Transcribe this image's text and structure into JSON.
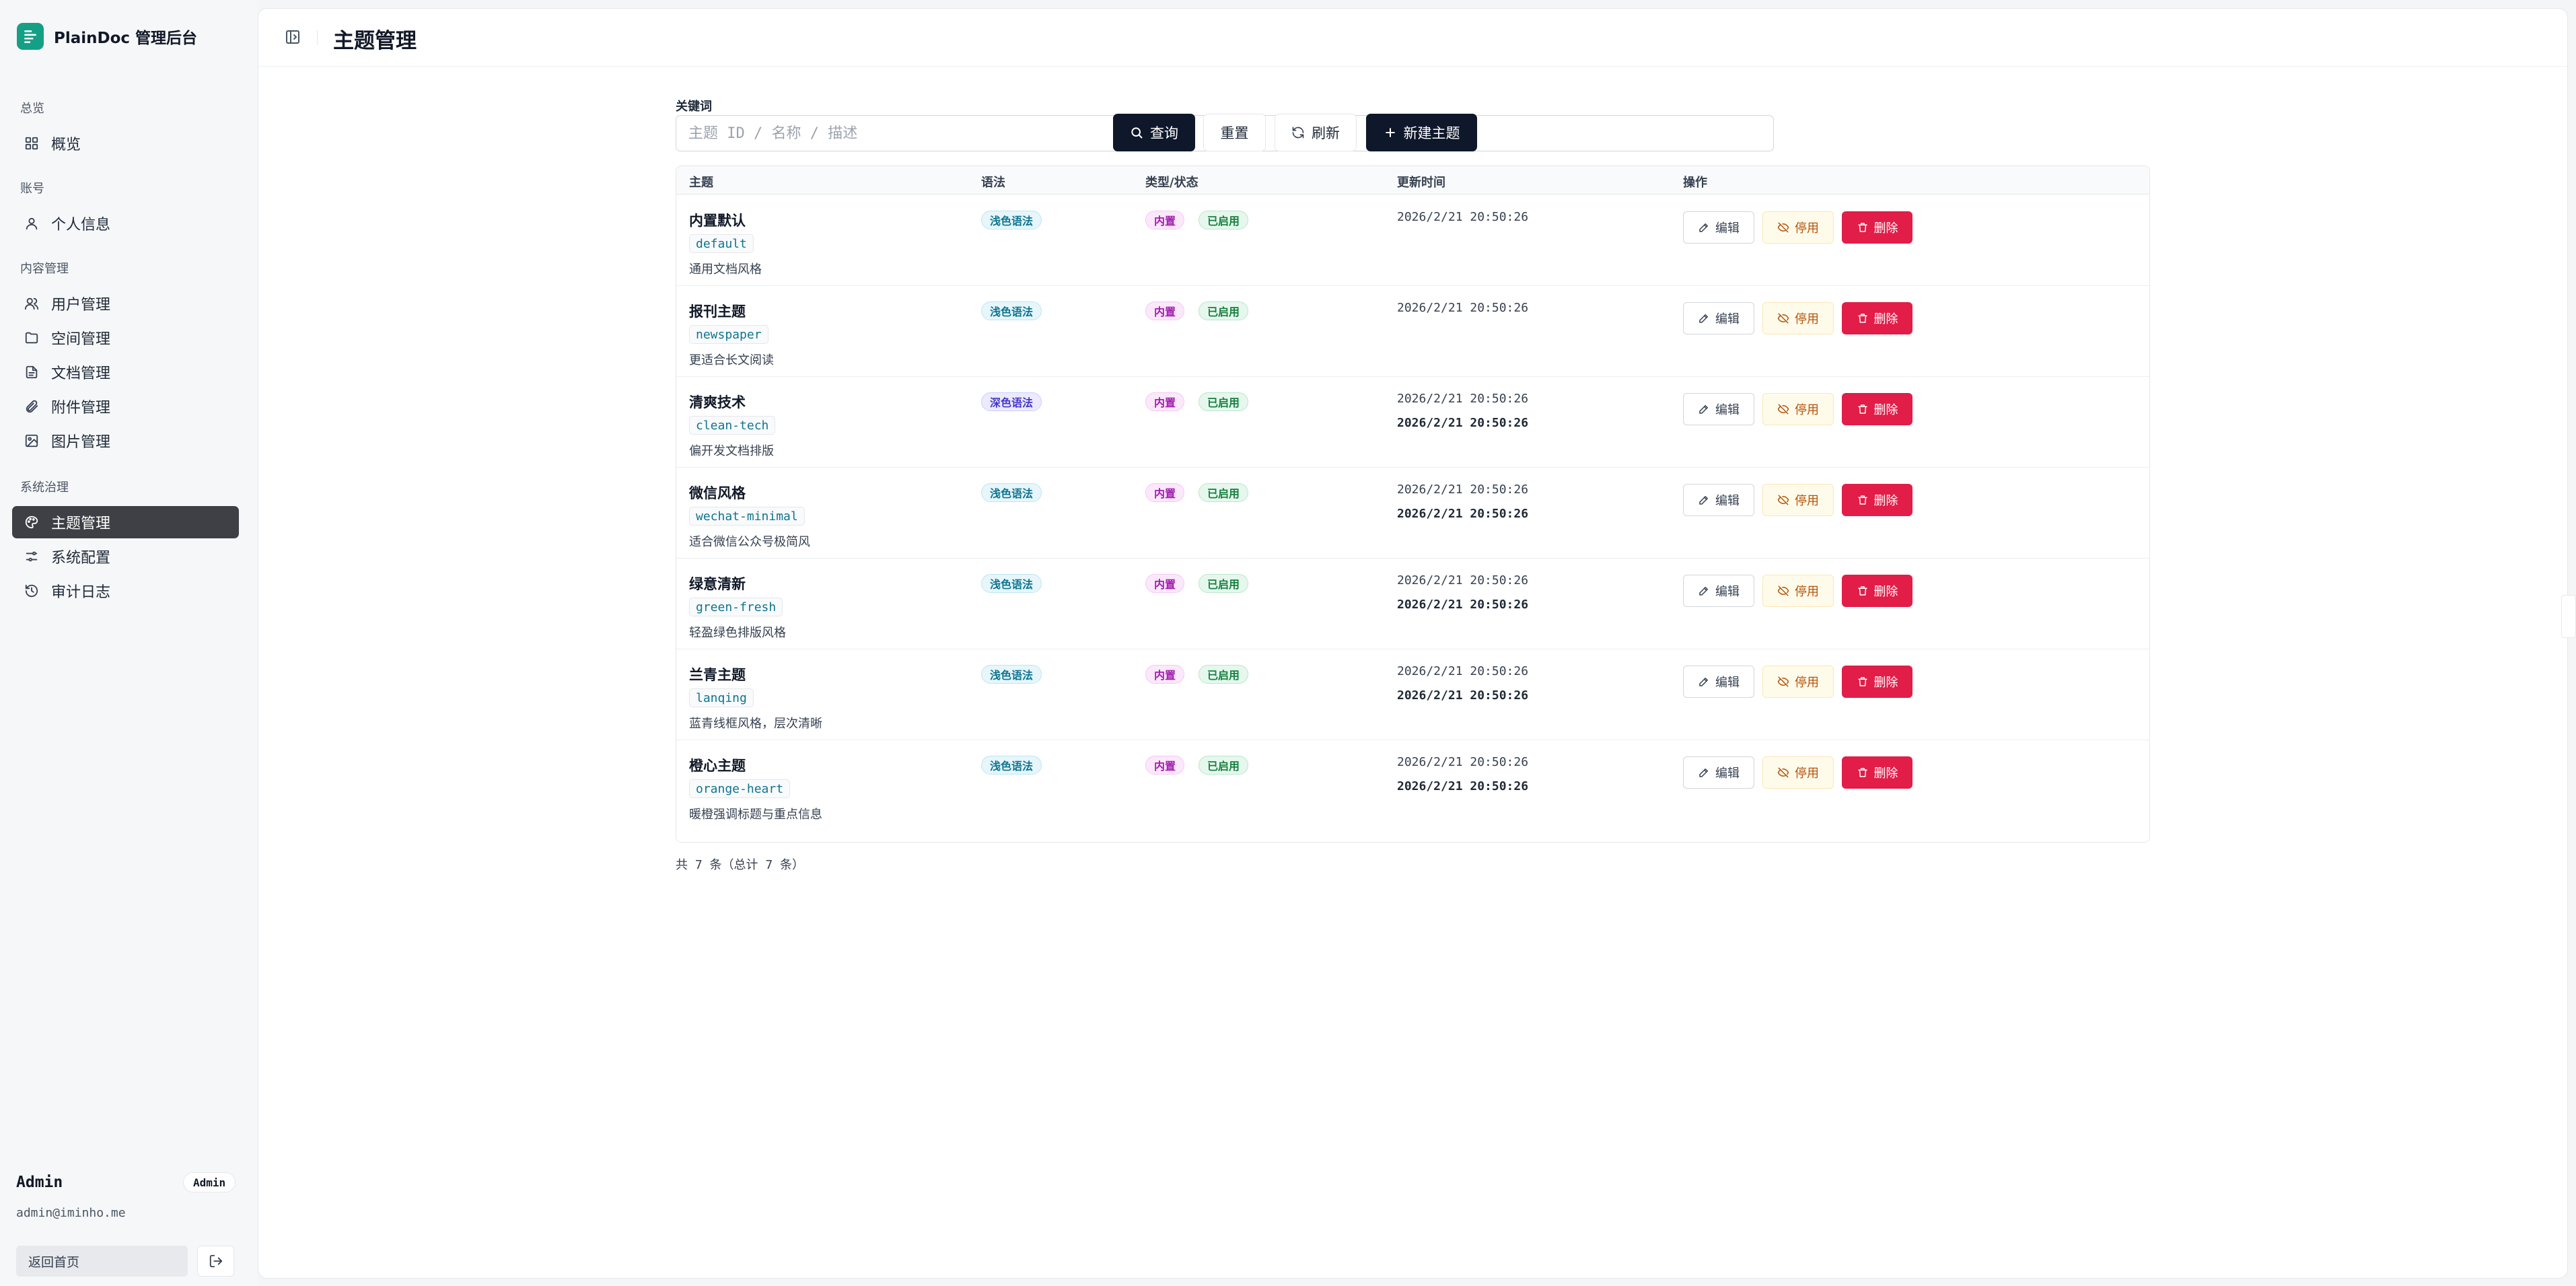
{
  "brand": {
    "title": "PlainDoc 管理后台",
    "color": "#14a085"
  },
  "sidebar": {
    "groups": [
      {
        "label": "总览",
        "items": [
          {
            "label": "概览",
            "icon": "dashboard-icon"
          }
        ]
      },
      {
        "label": "账号",
        "items": [
          {
            "label": "个人信息",
            "icon": "user-icon"
          }
        ]
      },
      {
        "label": "内容管理",
        "items": [
          {
            "label": "用户管理",
            "icon": "users-icon"
          },
          {
            "label": "空间管理",
            "icon": "folder-icon"
          },
          {
            "label": "文档管理",
            "icon": "file-text-icon"
          },
          {
            "label": "附件管理",
            "icon": "paperclip-icon"
          },
          {
            "label": "图片管理",
            "icon": "image-icon"
          }
        ]
      },
      {
        "label": "系统治理",
        "items": [
          {
            "label": "主题管理",
            "icon": "palette-icon",
            "active": true
          },
          {
            "label": "系统配置",
            "icon": "sliders-icon"
          },
          {
            "label": "审计日志",
            "icon": "history-icon"
          }
        ]
      }
    ],
    "user": {
      "name": "Admin",
      "role": "Admin",
      "email": "admin@iminho.me"
    },
    "home_label": "返回首页"
  },
  "header": {
    "title": "主题管理"
  },
  "filter": {
    "label": "关键词",
    "placeholder": "主题 ID / 名称 / 描述",
    "value": "",
    "query_label": "查询",
    "reset_label": "重置",
    "refresh_label": "刷新",
    "new_label": "新建主题"
  },
  "table": {
    "columns": [
      "主题",
      "语法",
      "类型/状态",
      "更新时间",
      "操作"
    ],
    "rows": [
      {
        "name": "内置默认",
        "id": "default",
        "desc": "通用文档风格",
        "syntax": "浅色语法",
        "syntax_kind": "light",
        "type": "内置",
        "status": "已启用",
        "time1": "2026/2/21 20:50:26",
        "time2": ""
      },
      {
        "name": "报刊主题",
        "id": "newspaper",
        "desc": "更适合长文阅读",
        "syntax": "浅色语法",
        "syntax_kind": "light",
        "type": "内置",
        "status": "已启用",
        "time1": "2026/2/21 20:50:26",
        "time2": ""
      },
      {
        "name": "清爽技术",
        "id": "clean-tech",
        "desc": "偏开发文档排版",
        "syntax": "深色语法",
        "syntax_kind": "dark",
        "type": "内置",
        "status": "已启用",
        "time1": "2026/2/21 20:50:26",
        "time2": "2026/2/21 20:50:26"
      },
      {
        "name": "微信风格",
        "id": "wechat-minimal",
        "desc": "适合微信公众号极简风",
        "syntax": "浅色语法",
        "syntax_kind": "light",
        "type": "内置",
        "status": "已启用",
        "time1": "2026/2/21 20:50:26",
        "time2": "2026/2/21 20:50:26"
      },
      {
        "name": "绿意清新",
        "id": "green-fresh",
        "desc": "轻盈绿色排版风格",
        "syntax": "浅色语法",
        "syntax_kind": "light",
        "type": "内置",
        "status": "已启用",
        "time1": "2026/2/21 20:50:26",
        "time2": "2026/2/21 20:50:26"
      },
      {
        "name": "兰青主题",
        "id": "lanqing",
        "desc": "蓝青线框风格，层次清晰",
        "syntax": "浅色语法",
        "syntax_kind": "light",
        "type": "内置",
        "status": "已启用",
        "time1": "2026/2/21 20:50:26",
        "time2": "2026/2/21 20:50:26"
      },
      {
        "name": "橙心主题",
        "id": "orange-heart",
        "desc": "暖橙强调标题与重点信息",
        "syntax": "浅色语法",
        "syntax_kind": "light",
        "type": "内置",
        "status": "已启用",
        "time1": "2026/2/21 20:50:26",
        "time2": "2026/2/21 20:50:26"
      }
    ],
    "actions": {
      "edit": "编辑",
      "disable": "停用",
      "delete": "删除"
    }
  },
  "footer": {
    "count_text": "共 7 条（总计 7 条）"
  },
  "colors": {
    "primary": "#0f172a",
    "danger": "#e11d48",
    "warning": "#b45309",
    "accent": "#14a085"
  }
}
